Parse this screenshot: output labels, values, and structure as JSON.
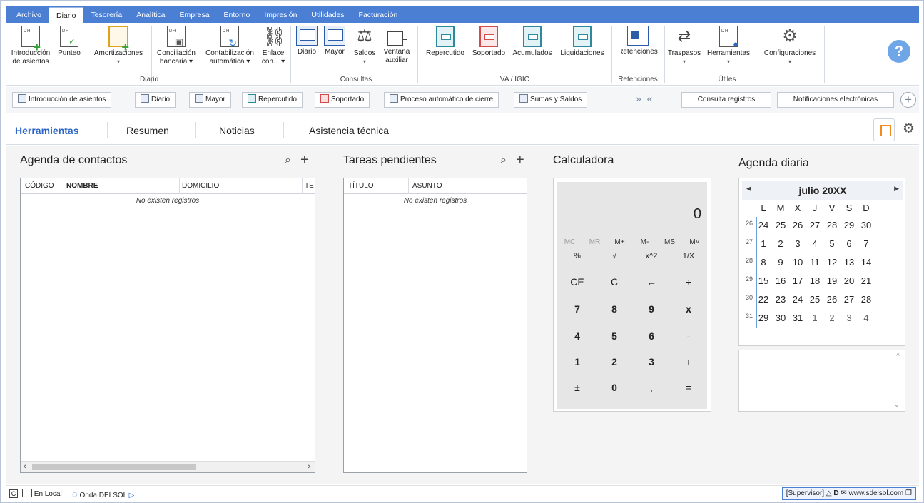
{
  "menu": [
    {
      "label": "Archivo",
      "active": false
    },
    {
      "label": "Diario",
      "active": true
    },
    {
      "label": "Tesorería",
      "active": false
    },
    {
      "label": "Analítica",
      "active": false
    },
    {
      "label": "Empresa",
      "active": false
    },
    {
      "label": "Entorno",
      "active": false
    },
    {
      "label": "Impresión",
      "active": false
    },
    {
      "label": "Utilidades",
      "active": false
    },
    {
      "label": "Facturación",
      "active": false
    }
  ],
  "ribbon": {
    "intro_label_1": "Introducción",
    "intro_label_2": "de asientos",
    "punteo": "Punteo",
    "amortizaciones": "Amortizaciones",
    "conciliacion_1": "Conciliación",
    "conciliacion_2": "bancaria",
    "contabilizacion_1": "Contabilización",
    "contabilizacion_2": "automática",
    "enlace_1": "Enlace",
    "enlace_2": "con...",
    "diario": "Diario",
    "mayor": "Mayor",
    "saldos": "Saldos",
    "ventana_1": "Ventana",
    "ventana_2": "auxiliar",
    "repercutido": "Repercutido",
    "soportado": "Soportado",
    "acumulados": "Acumulados",
    "liquidaciones": "Liquidaciones",
    "retenciones": "Retenciones",
    "traspasos": "Traspasos",
    "herramientas": "Herramientas",
    "configuraciones": "Configuraciones",
    "group_diario": "Diario",
    "group_consultas": "Consultas",
    "group_iva": "IVA / IGIC",
    "group_retenciones": "Retenciones",
    "group_utiles": "Útiles",
    "help": "?"
  },
  "quickbar": {
    "intro": "Introducción de asientos",
    "diario": "Diario",
    "mayor": "Mayor",
    "repercutido": "Repercutido",
    "soportado": "Soportado",
    "cierre": "Proceso automático de cierre",
    "sumas": "Sumas y Saldos",
    "arrows": "» «",
    "consulta": "Consulta registros",
    "notificaciones": "Notificaciones electrónicas",
    "add": "+"
  },
  "tabs": [
    "Herramientas",
    "Resumen",
    "Noticias",
    "Asistencia técnica"
  ],
  "contacts": {
    "title": "Agenda de contactos",
    "columns": [
      "CÓDIGO",
      "NOMBRE",
      "DOMICILIO",
      "TE"
    ],
    "empty": "No existen registros"
  },
  "tasks": {
    "title": "Tareas pendientes",
    "columns": [
      "TÍTULO",
      "ASUNTO"
    ],
    "empty": "No existen registros"
  },
  "calculator": {
    "title": "Calculadora",
    "display": "0",
    "memory": [
      "MC",
      "MR",
      "M+",
      "M-",
      "MS",
      "M˅"
    ],
    "keys": [
      [
        "%",
        "√",
        "x^2",
        "1/X"
      ],
      [
        "CE",
        "C",
        "←",
        "÷"
      ],
      [
        "7",
        "8",
        "9",
        "x"
      ],
      [
        "4",
        "5",
        "6",
        "-"
      ],
      [
        "1",
        "2",
        "3",
        "+"
      ],
      [
        "±",
        "0",
        ",",
        "="
      ]
    ]
  },
  "agenda": {
    "title": "Agenda diaria",
    "month": "julio 20XX",
    "weekdays": [
      "L",
      "M",
      "X",
      "J",
      "V",
      "S",
      "D"
    ],
    "weeks": [
      {
        "n": "26",
        "days": [
          "24",
          "25",
          "26",
          "27",
          "28",
          "29",
          "30"
        ]
      },
      {
        "n": "27",
        "days": [
          "1",
          "2",
          "3",
          "4",
          "5",
          "6",
          "7"
        ]
      },
      {
        "n": "28",
        "days": [
          "8",
          "9",
          "10",
          "11",
          "12",
          "13",
          "14"
        ]
      },
      {
        "n": "29",
        "days": [
          "15",
          "16",
          "17",
          "18",
          "19",
          "20",
          "21"
        ]
      },
      {
        "n": "30",
        "days": [
          "22",
          "23",
          "24",
          "25",
          "26",
          "27",
          "28"
        ]
      },
      {
        "n": "31",
        "days": [
          "29",
          "30",
          "31",
          "1",
          "2",
          "3",
          "4"
        ]
      }
    ]
  },
  "status": {
    "c": "C",
    "local": "En Local",
    "onda": "Onda DELSOL",
    "supervisor": "[Supervisor]",
    "d": "D",
    "web": "www.sdelsol.com"
  }
}
